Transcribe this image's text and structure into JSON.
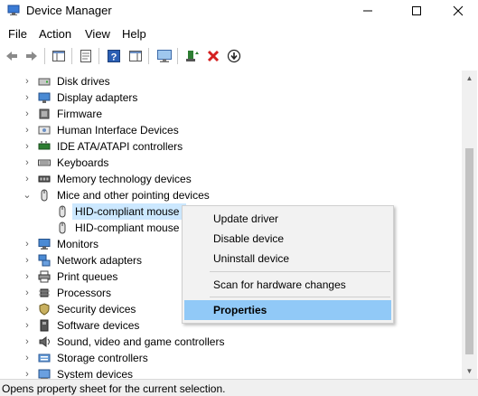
{
  "window": {
    "title": "Device Manager",
    "min_glyph": "—",
    "max_glyph": "☐",
    "close_glyph": "✕"
  },
  "menubar": {
    "items": [
      "File",
      "Action",
      "View",
      "Help"
    ]
  },
  "toolbar": {
    "buttons": [
      "back-arrow-icon",
      "forward-arrow-icon",
      "show-hide-console-tree-icon",
      "properties-icon",
      "help-icon",
      "action-pane-icon",
      "monitor-icon",
      "update-driver-icon",
      "uninstall-x-icon",
      "download-circle-icon"
    ]
  },
  "tree": {
    "items": [
      {
        "label": "Disk drives",
        "icon": "disk-drive-icon",
        "expander": "›",
        "level": 0
      },
      {
        "label": "Display adapters",
        "icon": "display-adapter-icon",
        "expander": "›",
        "level": 0
      },
      {
        "label": "Firmware",
        "icon": "firmware-icon",
        "expander": "›",
        "level": 0
      },
      {
        "label": "Human Interface Devices",
        "icon": "hid-icon",
        "expander": "›",
        "level": 0
      },
      {
        "label": "IDE ATA/ATAPI controllers",
        "icon": "ide-controller-icon",
        "expander": "›",
        "level": 0
      },
      {
        "label": "Keyboards",
        "icon": "keyboard-icon",
        "expander": "›",
        "level": 0
      },
      {
        "label": "Memory technology devices",
        "icon": "memory-icon",
        "expander": "›",
        "level": 0
      },
      {
        "label": "Mice and other pointing devices",
        "icon": "mouse-icon",
        "expander": "⌄",
        "level": 0
      },
      {
        "label": "HID-compliant mouse",
        "icon": "mouse-icon",
        "expander": "",
        "level": 1,
        "selected": true
      },
      {
        "label": "HID-compliant mouse",
        "icon": "mouse-icon",
        "expander": "",
        "level": 1
      },
      {
        "label": "Monitors",
        "icon": "monitor-icon",
        "expander": "›",
        "level": 0
      },
      {
        "label": "Network adapters",
        "icon": "network-adapter-icon",
        "expander": "›",
        "level": 0
      },
      {
        "label": "Print queues",
        "icon": "printer-icon",
        "expander": "›",
        "level": 0
      },
      {
        "label": "Processors",
        "icon": "processor-icon",
        "expander": "›",
        "level": 0
      },
      {
        "label": "Security devices",
        "icon": "security-device-icon",
        "expander": "›",
        "level": 0
      },
      {
        "label": "Software devices",
        "icon": "software-device-icon",
        "expander": "›",
        "level": 0
      },
      {
        "label": "Sound, video and game controllers",
        "icon": "speaker-icon",
        "expander": "›",
        "level": 0
      },
      {
        "label": "Storage controllers",
        "icon": "storage-controller-icon",
        "expander": "›",
        "level": 0
      },
      {
        "label": "System devices",
        "icon": "system-device-icon",
        "expander": "›",
        "level": 0
      }
    ]
  },
  "context_menu": {
    "items": [
      "Update driver",
      "Disable device",
      "Uninstall device",
      "Scan for hardware changes",
      "Properties"
    ],
    "highlighted": "Properties"
  },
  "statusbar": {
    "text": "Opens property sheet for the current selection."
  },
  "colors": {
    "selection": "#cce8ff",
    "menu_highlight": "#91c9f7",
    "delete_red": "#d42020",
    "help_blue": "#2b5fb4"
  }
}
